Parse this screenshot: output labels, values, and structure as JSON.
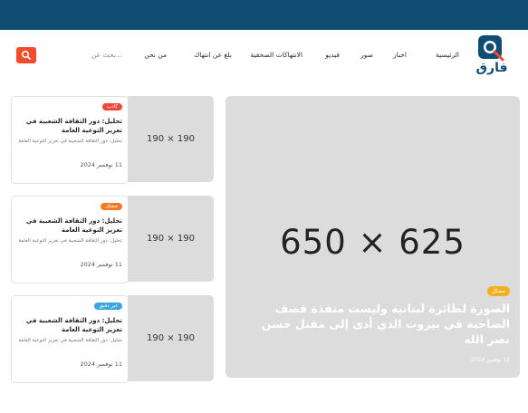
{
  "site": {
    "logo_text": "فارق"
  },
  "nav": {
    "items": [
      {
        "label": "الرئيسية"
      },
      {
        "label": "اخبار"
      },
      {
        "label": "صور"
      },
      {
        "label": "فيديو"
      },
      {
        "label": "الانتهاكات الصحفية"
      },
      {
        "label": "بلغ عن انتهاك"
      },
      {
        "label": "من نحن"
      }
    ],
    "search_placeholder": "بحث عن..."
  },
  "hero": {
    "placeholder": "650 × 625",
    "badge": "مضلل",
    "title": "الصورة لطائرة لبنانية وليست منفذة قصف الضاحية في بيروت الذي أدى إلى مقتل حسن نصر الله",
    "date": "11 نوفمبر 2024"
  },
  "cards": [
    {
      "placeholder": "190 × 190",
      "badge": "كاذب",
      "badge_color": "#f2483b",
      "title": "تحليل: دور الثقافة الشعبية في تعزيز التوعية العامة",
      "subtitle": "تحليل: دور الثقافة الشعبية في تعزيز التوعية العامة",
      "date": "11 نوفمبر 2024"
    },
    {
      "placeholder": "190 × 190",
      "badge": "مضلل",
      "badge_color": "#f47a1f",
      "title": "تحليل: دور الثقافة الشعبية في تعزيز التوعية العامة",
      "subtitle": "تحليل: دور الثقافة الشعبية في تعزيز التوعية العامة",
      "date": "11 نوفمبر 2024"
    },
    {
      "placeholder": "190 × 190",
      "badge": "غير دقيق",
      "badge_color": "#3aa6e0",
      "title": "تحليل: دور الثقافة الشعبية في تعزيز التوعية العامة",
      "subtitle": "تحليل: دور الثقافة الشعبية في تعزيز التوعية العامة",
      "date": "11 نوفمبر 2024"
    }
  ],
  "colors": {
    "brand": "#0f4d73",
    "search_button": "#f34b2b",
    "hero_badge": "#f2b01e"
  }
}
